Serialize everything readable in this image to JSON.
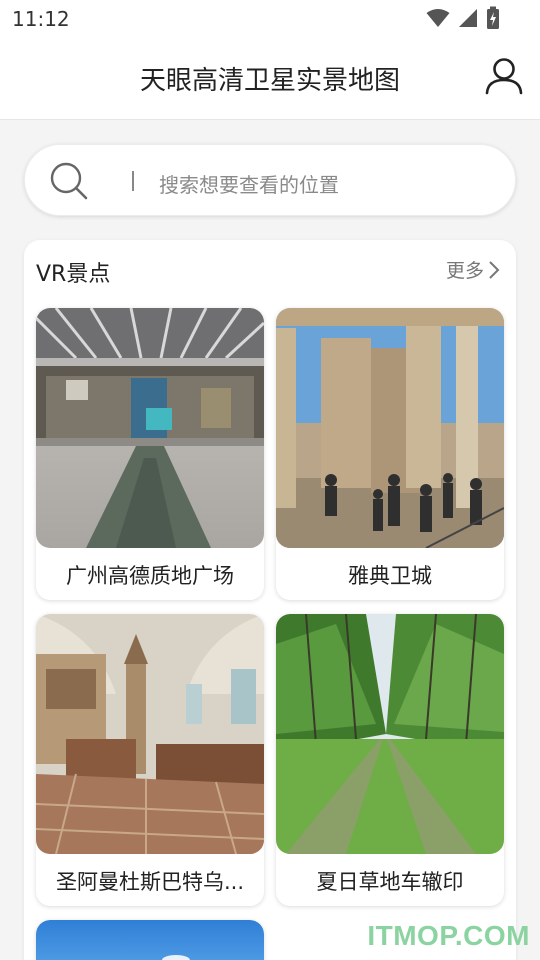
{
  "status_bar": {
    "time": "11:12"
  },
  "header": {
    "title": "天眼高清卫星实景地图"
  },
  "search": {
    "placeholder": "搜索想要查看的位置"
  },
  "vr_section": {
    "title": "VR景点",
    "more": "更多",
    "items": [
      {
        "label": "广州高德质地广场"
      },
      {
        "label": "雅典卫城"
      },
      {
        "label": "圣阿曼杜斯巴特乌..."
      },
      {
        "label": "夏日草地车辙印"
      }
    ]
  },
  "watermark": "ITMOP.COM"
}
